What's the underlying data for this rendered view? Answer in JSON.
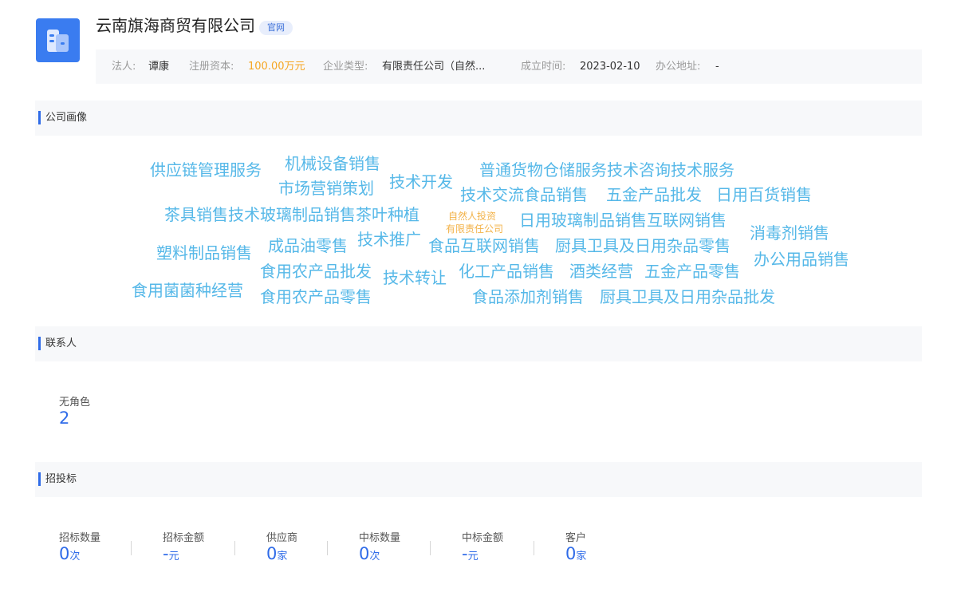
{
  "header": {
    "company_name": "云南旗海商贸有限公司",
    "official_badge": "官网",
    "logo_icon": "building-icon",
    "info": {
      "legal_rep_label": "法人:",
      "legal_rep_value": "谭康",
      "reg_capital_label": "注册资本:",
      "reg_capital_value": "100.00万元",
      "company_type_label": "企业类型:",
      "company_type_value": "有限责任公司（自然...",
      "founded_label": "成立时间:",
      "founded_value": "2023-02-10",
      "address_label": "办公地址:",
      "address_value": "-"
    }
  },
  "sections": {
    "portrait_title": "公司画像",
    "contacts_title": "联系人",
    "bidding_title": "招投标"
  },
  "word_cloud": [
    "供应链管理服务",
    "机械设备销售",
    "普通货物仓储服务技术咨询技术服务",
    "市场营销策划",
    "技术开发",
    "技术交流食品销售",
    "五金产品批发",
    "日用百货销售",
    "茶具销售技术玻璃制品销售茶叶种植",
    "自然人投资",
    "有限责任公司",
    "日用玻璃制品销售互联网销售",
    "消毒剂销售",
    "塑料制品销售",
    "成品油零售",
    "技术推广",
    "食品互联网销售",
    "厨具卫具及日用杂品零售",
    "办公用品销售",
    "食用农产品批发",
    "技术转让",
    "化工产品销售",
    "酒类经营",
    "五金产品零售",
    "食用菌菌种经营",
    "食用农产品零售",
    "食品添加剂销售",
    "厨具卫具及日用杂品批发"
  ],
  "contacts": {
    "role_label": "无角色",
    "role_count": "2"
  },
  "bidding": [
    {
      "label": "招标数量",
      "value": "0",
      "unit": "次"
    },
    {
      "label": "招标金额",
      "value": "-",
      "unit": "元"
    },
    {
      "label": "供应商",
      "value": "0",
      "unit": "家"
    },
    {
      "label": "中标数量",
      "value": "0",
      "unit": "次"
    },
    {
      "label": "中标金额",
      "value": "-",
      "unit": "元"
    },
    {
      "label": "客户",
      "value": "0",
      "unit": "家"
    }
  ],
  "colors": {
    "accent": "#2f6be8",
    "logo": "#3a7cf0",
    "cloud_word": "#56b8e8",
    "cloud_word_small": "#f3b34a",
    "capital": "#f5a623"
  }
}
